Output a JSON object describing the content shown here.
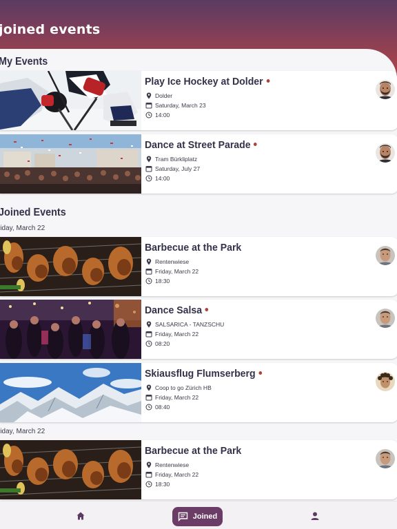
{
  "header": {
    "title": "joined events"
  },
  "sections": {
    "my_events_title": "My Events",
    "joined_events_title": "Joined Events"
  },
  "date_groups": [
    "riday, March 22",
    "riday, March 22"
  ],
  "my_events": [
    {
      "title": "Play Ice Hockey at Dolder",
      "location": "Dolder",
      "date": "Saturday, March 23",
      "time": "14:00",
      "image": "ice-hockey-photo",
      "avatar": "bearded-man-avatar"
    },
    {
      "title": "Dance at Street Parade",
      "location": "Tram Bürkliplatz",
      "date": "Saturday, July 27",
      "time": "14:00",
      "image": "street-parade-crowd-photo",
      "avatar": "bearded-man-avatar"
    }
  ],
  "joined_events": [
    {
      "title": "Barbecue at the Park",
      "location": "Rentenwiese",
      "date": "Friday, March 22",
      "time": "18:30",
      "image": "barbecue-grill-photo",
      "avatar": "man-avatar",
      "dot": false
    },
    {
      "title": "Dance Salsa",
      "location": "SALSARICA - TANZSCHU",
      "date": "Friday, March 22",
      "time": "08:20",
      "image": "salsa-party-photo",
      "avatar": "man-avatar",
      "dot": true
    },
    {
      "title": "Skiausflug Flumserberg",
      "location": "Coop to go Zürich HB",
      "date": "Friday, March 22",
      "time": "08:40",
      "image": "snowy-mountains-photo",
      "avatar": "curly-hair-avatar",
      "dot": true
    },
    {
      "title": "Barbecue at the Park",
      "location": "Rentenwiese",
      "date": "Friday, March 22",
      "time": "18:30",
      "image": "barbecue-grill-photo",
      "avatar": "man-avatar",
      "dot": false
    }
  ],
  "bottom_nav": {
    "joined_label": "Joined",
    "icons": [
      "home-icon",
      "chat-icon",
      "person-icon"
    ]
  },
  "colors": {
    "accent": "#6b3d66",
    "dot": "#a8463d",
    "header_top": "#5b3b63",
    "header_bottom": "#a0434c",
    "text": "#33324a"
  }
}
